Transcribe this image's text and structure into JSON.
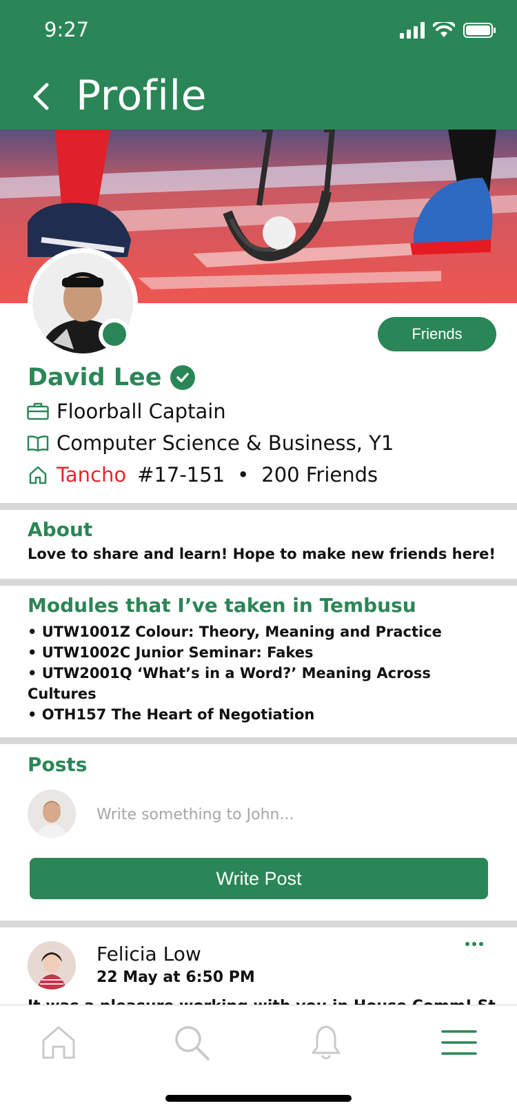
{
  "status_bar": {
    "time": "9:27"
  },
  "header": {
    "title": "Profile"
  },
  "profile": {
    "name": "David Lee",
    "friends_button": "Friends",
    "role": "Floorball Captain",
    "course": "Computer Science & Business, Y1",
    "house": "Tancho",
    "room": "#17-151",
    "separator": "•",
    "friends_count": "200 Friends"
  },
  "about": {
    "title": "About",
    "text": "Love to share and learn! Hope to make new friends here!"
  },
  "modules": {
    "title": "Modules that I’ve taken in Tembusu",
    "items": [
      "UTW1001Z Colour: Theory, Meaning and Practice",
      "UTW1002C Junior Seminar: Fakes",
      "UTW2001Q ‘What’s in a Word?’ Meaning Across Cultures",
      "OTH157 The Heart of Negotiation"
    ]
  },
  "posts": {
    "title": "Posts",
    "input_placeholder": "Write something to John...",
    "write_button": "Write Post"
  },
  "feed": {
    "author": "Felicia Low",
    "time": "22 May at 6:50 PM",
    "text": "It was a pleasure working with you in House Comm! Stay"
  },
  "colors": {
    "primary": "#2a8656",
    "house": "#e8262b",
    "divider": "#d8d8d8"
  },
  "tabs": [
    "home-icon",
    "search-icon",
    "bell-icon",
    "menu-icon"
  ]
}
